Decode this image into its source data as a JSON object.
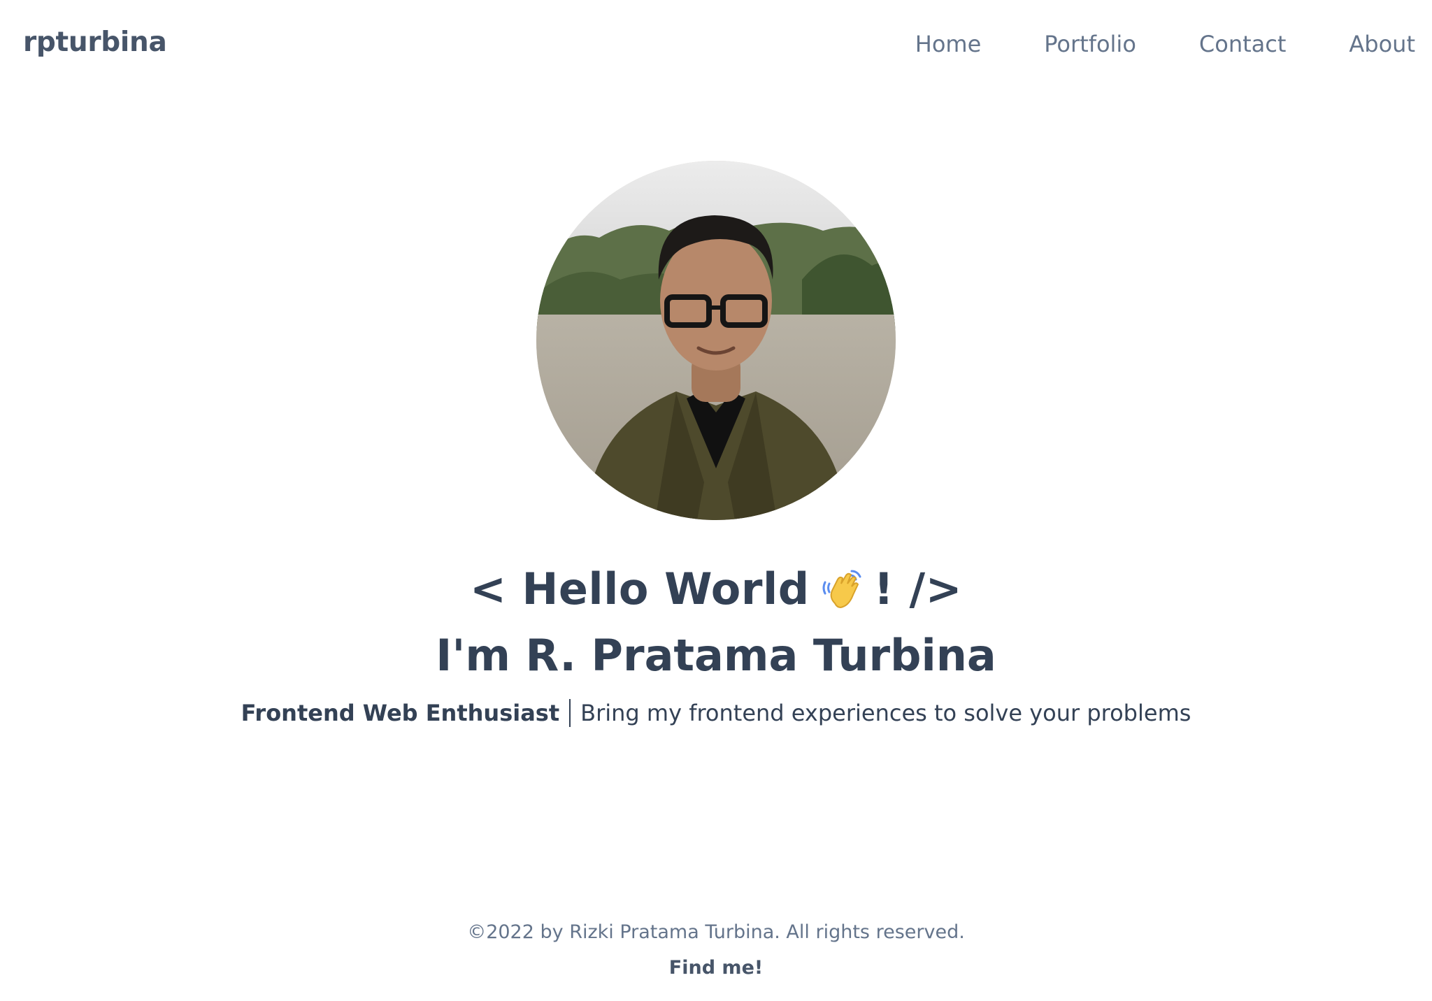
{
  "header": {
    "brand": "rpturbina",
    "nav": [
      {
        "label": "Home"
      },
      {
        "label": "Portfolio"
      },
      {
        "label": "Contact"
      },
      {
        "label": "About"
      }
    ]
  },
  "hero": {
    "greeting_prefix": "< Hello World",
    "greeting_suffix": "! />",
    "greeting_icon": "waving-hand",
    "name": "I'm R. Pratama Turbina",
    "role": "Frontend Web Enthusiast",
    "description": "Bring my frontend experiences to solve your problems",
    "avatar_alt": "profile-photo"
  },
  "footer": {
    "copyright": "©2022 by Rizki Pratama Turbina. All rights reserved.",
    "find_me": "Find me!"
  },
  "colors": {
    "text_primary": "#334155",
    "text_muted": "#64748b",
    "background": "#ffffff"
  }
}
